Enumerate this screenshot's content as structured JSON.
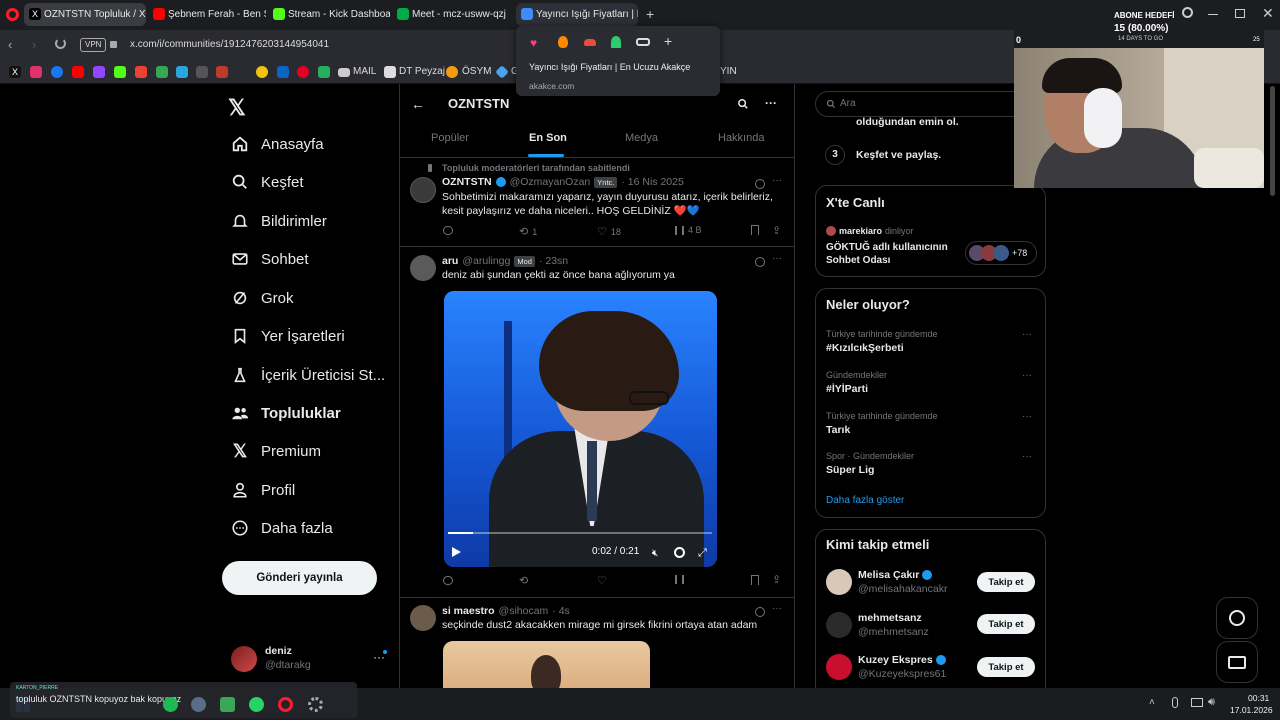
{
  "browser": {
    "tabs": [
      {
        "label": "OZNTSTN Topluluk / X"
      },
      {
        "label": "Şebnem Ferah - Ben Ş"
      },
      {
        "label": "Stream - Kick Dashboard"
      },
      {
        "label": "Meet - mcz-usww-qzj"
      },
      {
        "label": "Yayıncı Işığı Fiyatları | E"
      }
    ],
    "vpn": "VPN",
    "url": "x.com/i/communities/1912476203144954041",
    "bookmarks": [
      "MAIL",
      "DT Peyzaj",
      "ÖSYM",
      "G",
      "YIN"
    ],
    "popup": {
      "title": "Yayıncı Işığı Fiyatları | En Ucuzu Akakçe",
      "domain": "akakce.com"
    }
  },
  "stream_overlay": {
    "goal_label": "ABONE HEDEFİ",
    "goal_value": "15 (80.00%)",
    "days": "14 DAYS TO GO",
    "count": "0",
    "badge": "25"
  },
  "nav": {
    "items": [
      "Anasayfa",
      "Keşfet",
      "Bildirimler",
      "Sohbet",
      "Grok",
      "Yer İşaretleri",
      "İçerik Üreticisi St...",
      "Topluluklar",
      "Premium",
      "Profil",
      "Daha fazla"
    ],
    "post_button": "Gönderi yayınla",
    "account": {
      "name": "deniz",
      "handle": "@dtarakg",
      "more": "···"
    }
  },
  "community": {
    "title": "OZNTSTN",
    "tabs": [
      "Popüler",
      "En Son",
      "Medya",
      "Hakkında"
    ],
    "pinned_label": "Topluluk moderatörleri tarafından sabitlendi",
    "posts": [
      {
        "name": "OZNTSTN",
        "handle": "@OzmayanOzan",
        "badge": "Yntc.",
        "time": "· 16 Nis 2025",
        "text": "Sohbetimizi makaramızı yaparız, yayın duyurusu atarız, içerik belirleriz, kesit paylaşırız ve daha niceleri.. HOŞ GELDİNİZ ❤️💙",
        "replies": "",
        "reposts": "1",
        "likes": "18",
        "views": "4 B"
      },
      {
        "name": "aru",
        "handle": "@arulingg",
        "badge": "Mod",
        "time": "· 23sn",
        "text": "deniz abi şundan çekti az önce bana ağlıyorum ya",
        "video_time": "0:02 / 0:21"
      },
      {
        "name": "si maestro",
        "handle": "@sihocam",
        "time": "· 4s",
        "text": "seçkinde dust2 akacakken mirage mi girsek fikrini ortaya atan adam"
      }
    ]
  },
  "right": {
    "search_placeholder": "Ara",
    "steps": {
      "partial": "olduğundan emin ol.",
      "num": "3",
      "label": "Keşfet ve paylaş."
    },
    "live": {
      "heading": "X'te Canlı",
      "host": "marekiaro",
      "host_suffix": "dinliyor",
      "room": "GÖKTUĞ adlı kullanıcının Sohbet Odası",
      "count": "+78"
    },
    "trends": {
      "heading": "Neler oluyor?",
      "items": [
        {
          "context": "Türkiye tarihinde gündemde",
          "title": "#KızılcıkŞerbeti"
        },
        {
          "context": "Gündemdekiler",
          "title": "#İYİParti"
        },
        {
          "context": "Türkiye tarihinde gündemde",
          "title": "Tarık"
        },
        {
          "context": "Spor · Gündemdekiler",
          "title": "Süper Lig"
        }
      ],
      "more": "Daha fazla göster"
    },
    "who": {
      "heading": "Kimi takip etmeli",
      "follow_label": "Takip et",
      "users": [
        {
          "name": "Melisa Çakır",
          "handle": "@melisahakancakr"
        },
        {
          "name": "mehmetsanz",
          "handle": "@mehmetsanz"
        },
        {
          "name": "Kuzey Ekspres",
          "handle": "@Kuzeyekspres61"
        }
      ]
    }
  },
  "taskbar": {
    "notification_title": "KARTON_PIERRE",
    "notification": "topluluk OZNTSTN kopuyoz bak kopuyoz",
    "time": "00:31",
    "date": "17.01.2026"
  },
  "colors": {
    "accent": "#1d9bf0",
    "background": "#000000",
    "border": "#2f3336"
  }
}
